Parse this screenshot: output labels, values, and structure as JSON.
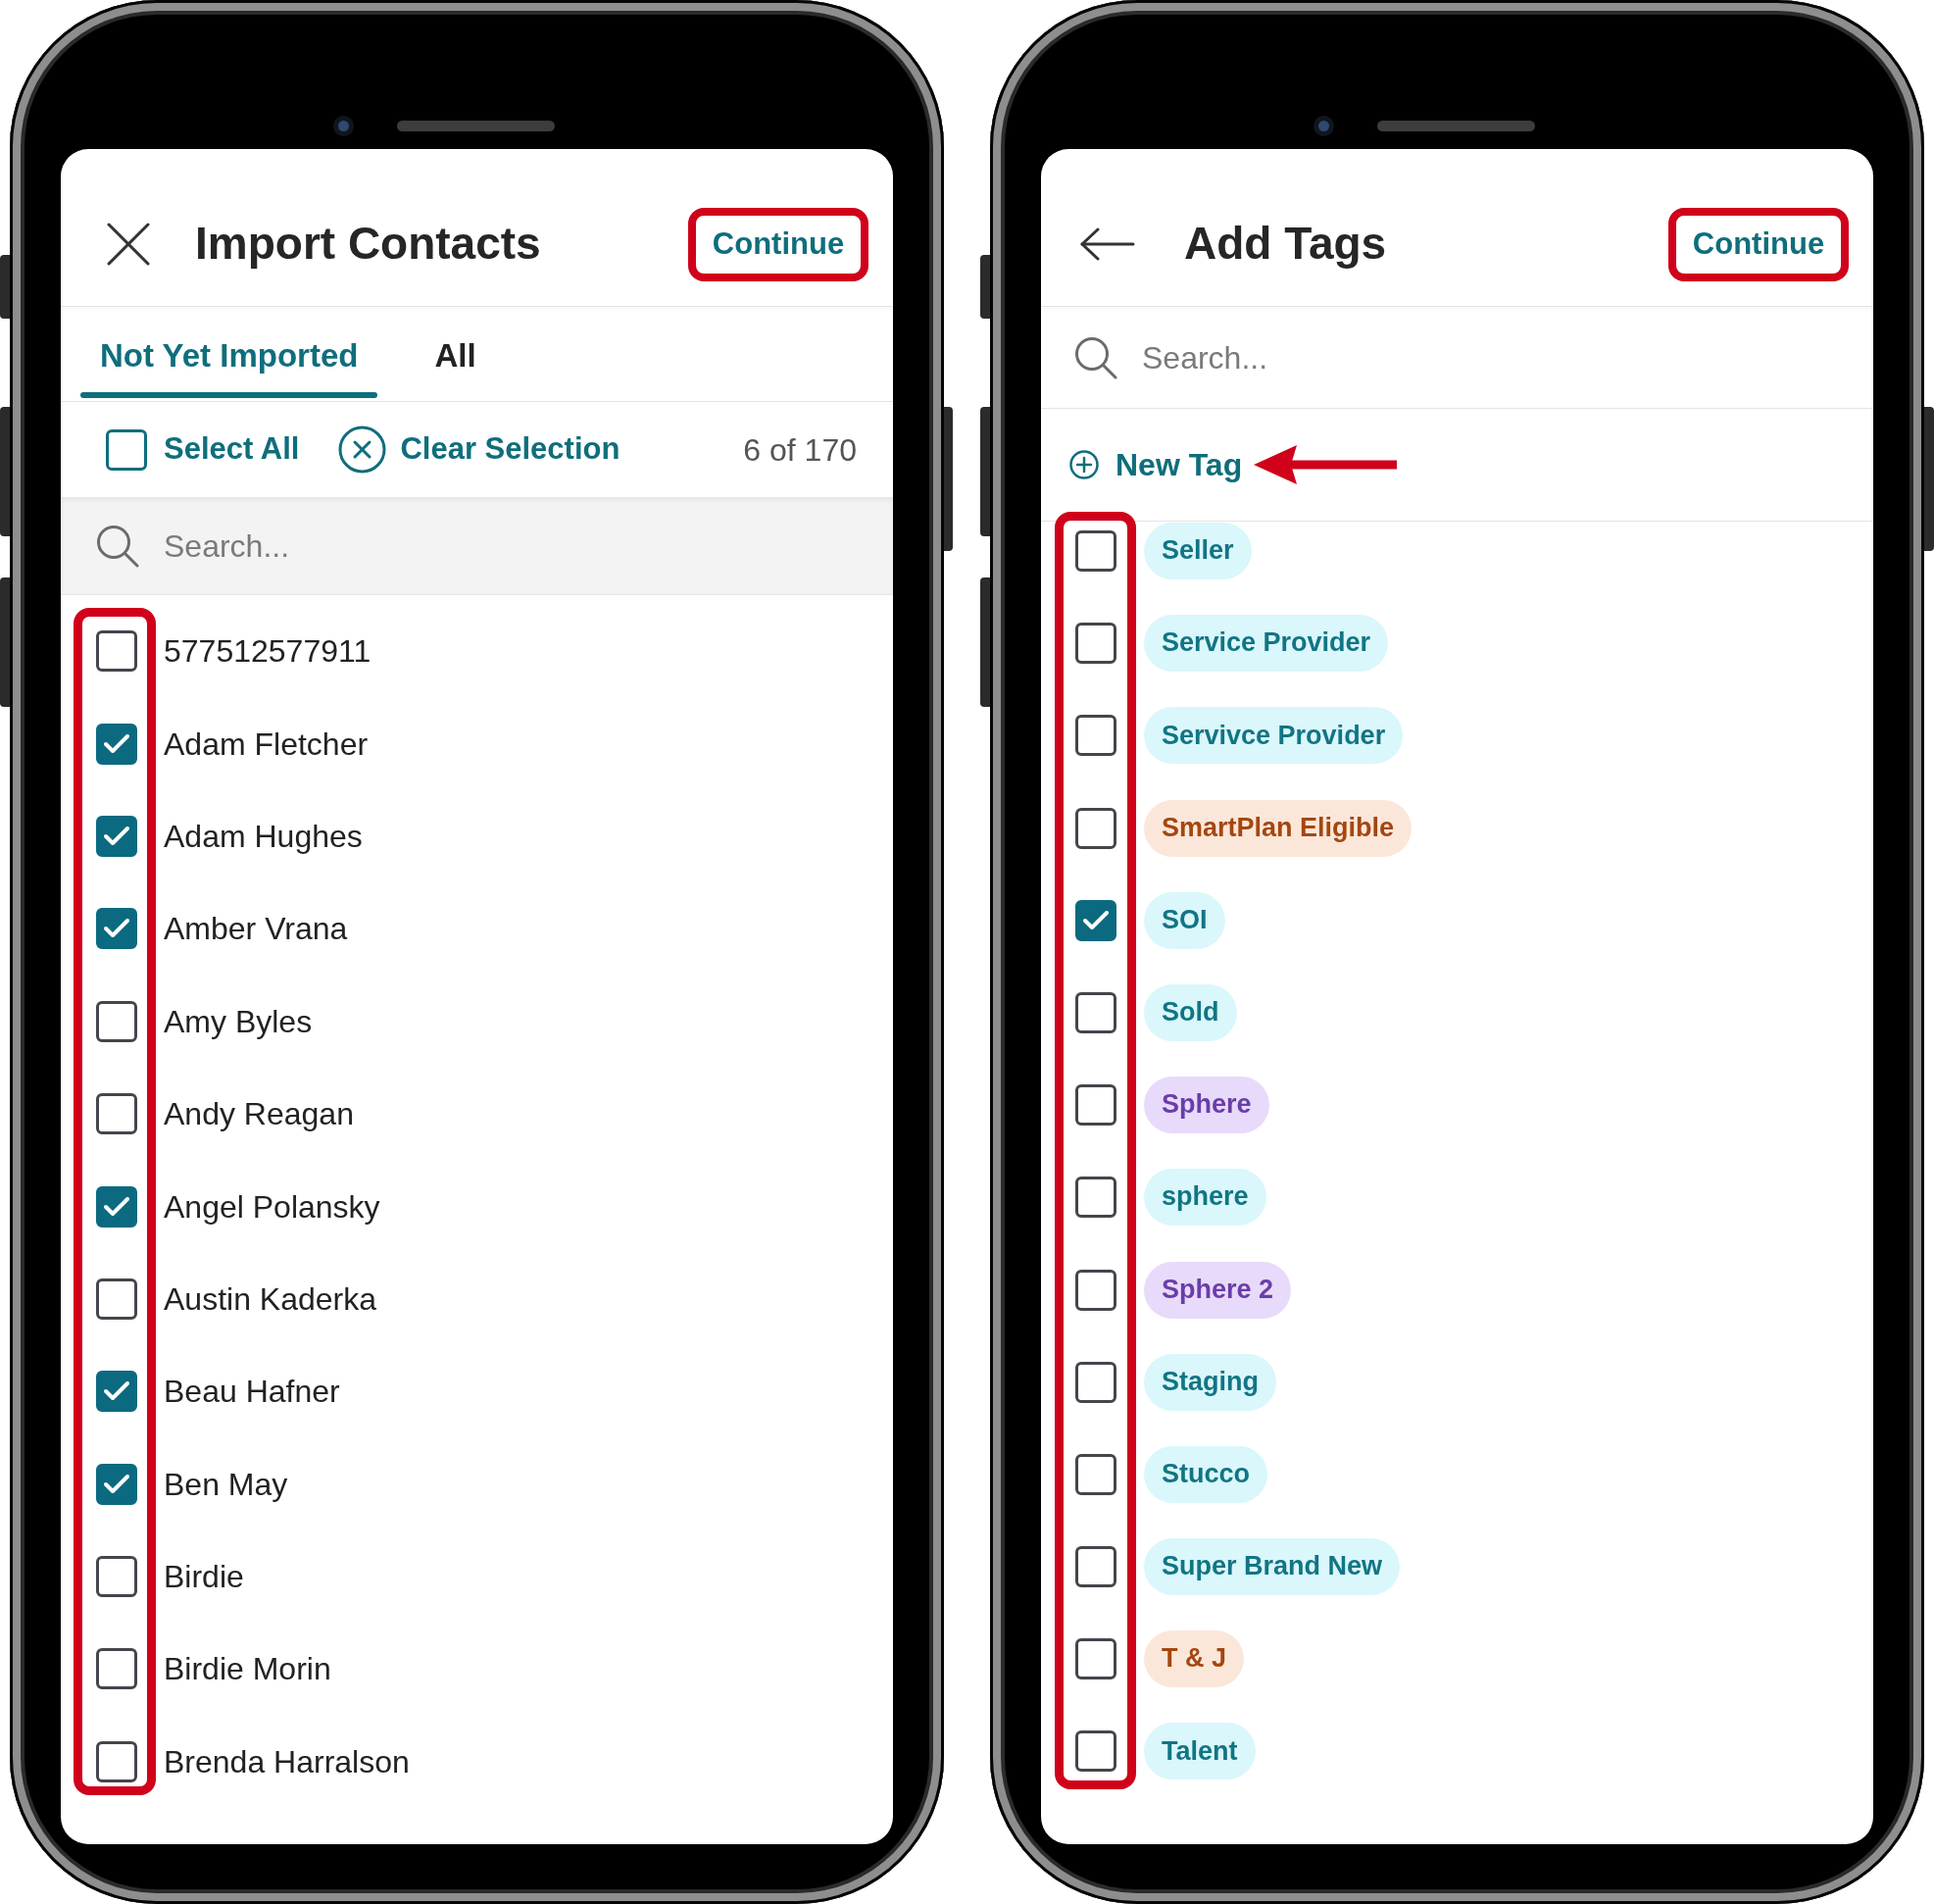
{
  "import_contacts": {
    "title": "Import Contacts",
    "action": "Continue",
    "tabs": [
      {
        "label": "Not Yet Imported",
        "selected": true
      },
      {
        "label": "All",
        "selected": false
      }
    ],
    "select_all": {
      "label": "Select All",
      "checked": false
    },
    "clear_selection": "Clear Selection",
    "count": "6 of 170",
    "search": {
      "placeholder": "Search..."
    },
    "contacts": [
      {
        "name": "577512577911",
        "checked": false
      },
      {
        "name": "Adam Fletcher",
        "checked": true
      },
      {
        "name": "Adam Hughes",
        "checked": true
      },
      {
        "name": "Amber Vrana",
        "checked": true
      },
      {
        "name": "Amy Byles",
        "checked": false
      },
      {
        "name": "Andy Reagan",
        "checked": false
      },
      {
        "name": "Angel Polansky",
        "checked": true
      },
      {
        "name": "Austin Kaderka",
        "checked": false
      },
      {
        "name": "Beau Hafner",
        "checked": true
      },
      {
        "name": "Ben May",
        "checked": true
      },
      {
        "name": "Birdie",
        "checked": false
      },
      {
        "name": "Birdie Morin",
        "checked": false
      },
      {
        "name": "Brenda Harralson",
        "checked": false
      }
    ]
  },
  "add_tags": {
    "title": "Add Tags",
    "action": "Continue",
    "search": {
      "placeholder": "Search..."
    },
    "new_tag": "New Tag",
    "tags": [
      {
        "label": "Seller",
        "color": "#117584",
        "checked": false
      },
      {
        "label": "Service Provider",
        "color": "#117584",
        "checked": false
      },
      {
        "label": "Servivce Provider",
        "color": "#117584",
        "checked": false
      },
      {
        "label": "SmartPlan Eligible",
        "color": "#a4470f",
        "checked": false
      },
      {
        "label": "SOI",
        "color": "#117584",
        "checked": true
      },
      {
        "label": "Sold",
        "color": "#117584",
        "checked": false
      },
      {
        "label": "Sphere",
        "color": "#6a3ea8",
        "checked": false
      },
      {
        "label": "sphere",
        "color": "#117584",
        "checked": false
      },
      {
        "label": "Sphere 2",
        "color": "#6a3ea8",
        "checked": false
      },
      {
        "label": "Staging",
        "color": "#117584",
        "checked": false
      },
      {
        "label": "Stucco",
        "color": "#117584",
        "checked": false
      },
      {
        "label": "Super Brand New",
        "color": "#117584",
        "checked": false
      },
      {
        "label": "T & J",
        "color": "#a4470f",
        "checked": false
      },
      {
        "label": "Talent",
        "color": "#117584",
        "checked": false
      }
    ]
  }
}
